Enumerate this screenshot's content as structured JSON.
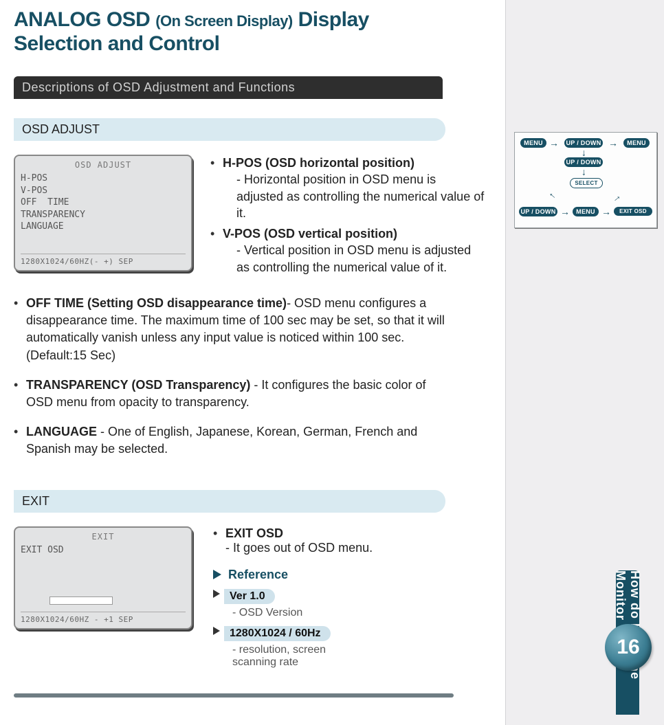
{
  "title": {
    "pre": "ANALOG OSD",
    "paren": "(On Screen Display)",
    "post1": "Display",
    "post2": "Selection and Control"
  },
  "darkbar": "Descriptions of OSD Adjustment and Functions",
  "section1": "OSD ADJUST",
  "osdbox1": {
    "title": "OSD  ADJUST",
    "items": [
      "H-POS",
      "V-POS",
      "OFF  TIME",
      "TRANSPARENCY",
      "LANGUAGE"
    ],
    "status": "1280X1024/60HZ(- +) SEP"
  },
  "hpos": {
    "head": "H-POS (OSD horizontal position)",
    "l1": "- Horizontal position  in OSD menu  is",
    "l2": "adjusted  as controlling the  numerical value of it."
  },
  "vpos": {
    "head": "V-POS (OSD vertical position)",
    "l1": "- Vertical position in OSD menu is adjusted",
    "l2": "as controlling the numerical value of it."
  },
  "offtime": {
    "head": "OFF TIME (Setting OSD disappearance time)",
    "body": "- OSD menu configures a disappearance time. The maximum time of 100 sec may be set, so that it will automatically vanish unless any input value is noticed within 100 sec.",
    "def": "(Default:15 Sec)"
  },
  "transp": {
    "head": "TRANSPARENCY (OSD Transparency)",
    "body": " - It configures the basic color of OSD menu from opacity to transparency."
  },
  "lang": {
    "head": "LANGUAGE",
    "body": "  - One of English,  Japanese,  Korean, German, French and Spanish may be selected."
  },
  "section2": "EXIT",
  "osdbox2": {
    "title": "EXIT",
    "items": [
      "EXIT OSD"
    ],
    "status": "1280X1024/60HZ - +1 SEP"
  },
  "exit": {
    "head": "EXIT OSD",
    "body": "- It goes out of OSD menu."
  },
  "reference": "Reference",
  "pill1": "Ver 1.0",
  "pill1desc": "- OSD Version",
  "pill2": "1280X1024 / 60Hz",
  "pill2desc": "- resolution, screen\n  scanning rate",
  "sideChips": {
    "menu": "MENU",
    "updown": "UP / DOWN",
    "select": "SELECT",
    "exitosd": "EXIT OSD"
  },
  "vtab": "How do I use the Monitor",
  "pageNum": "16"
}
